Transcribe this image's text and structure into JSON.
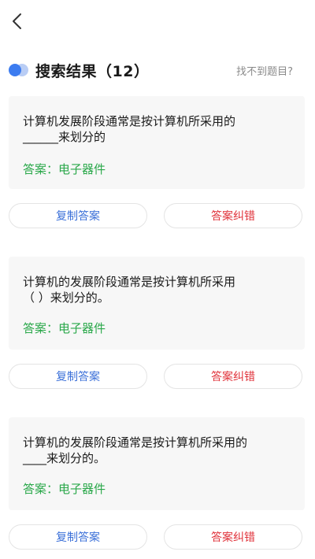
{
  "nav": {
    "back_icon": "chevron-left-icon"
  },
  "header": {
    "toggle_icon": "toggle-icon",
    "title": "搜索结果（12）",
    "link": "找不到题目?"
  },
  "colors": {
    "answer": "#2aa84a",
    "copy_button": "#3a6fd8",
    "correct_button": "#e0323a",
    "toggle_blue": "#3c7cf0",
    "toggle_light": "#b9cdf5"
  },
  "results": [
    {
      "question_line1": "计算机发展阶段通常是按计算机所采用的",
      "question_line2": "______来划分的",
      "answer": "答案：电子器件",
      "copy_label": "复制答案",
      "correct_label": "答案纠错"
    },
    {
      "question_line1": "计算机的发展阶段通常是按计算机所采用",
      "question_line2": "（ ）来划分的。",
      "answer": "答案：电子器件",
      "copy_label": "复制答案",
      "correct_label": "答案纠错"
    },
    {
      "question_line1": "计算机的发展阶段通常是按计算机所采用的",
      "question_line2": "____来划分的。",
      "answer": "答案：电子器件",
      "copy_label": "复制答案",
      "correct_label": "答案纠错"
    }
  ]
}
